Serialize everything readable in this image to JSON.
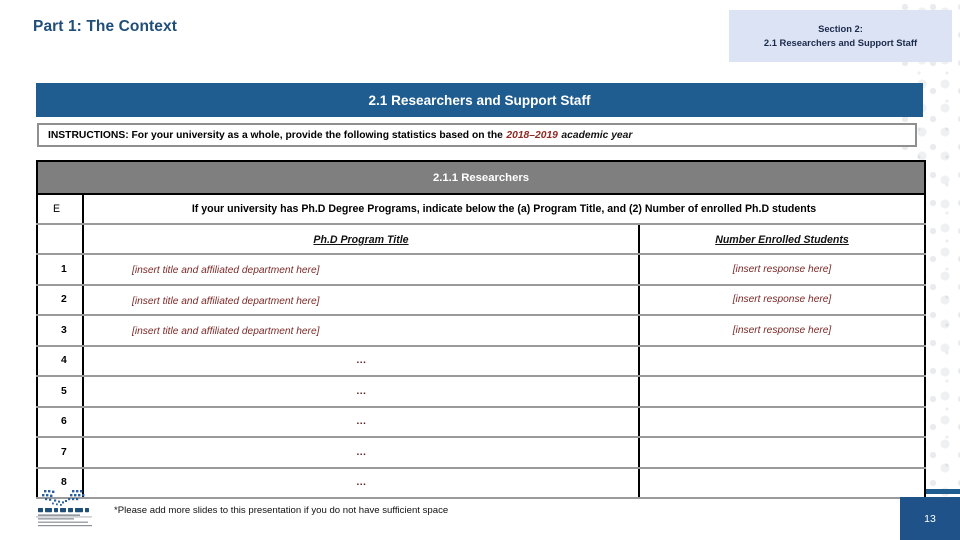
{
  "slide": {
    "title": "Part 1: The Context",
    "page_number": "13",
    "accent_blue": "#1f5c8f",
    "tag_bg": "#dce3f5",
    "subhead_gray": "#7f7f7f",
    "placeholder_red": "#7b2a28"
  },
  "section_tag": {
    "line1": "Section 2:",
    "line2": "2.1 Researchers and Support Staff"
  },
  "banner": {
    "label": "2.1 Researchers and Support Staff"
  },
  "instructions": {
    "lead": "INSTRUCTIONS: For your university as a whole, provide the following statistics based on the",
    "year": "2018–2019",
    "trailing": "academic year"
  },
  "table": {
    "subhead": "2.1.1 Researchers",
    "prompt_letter": "E",
    "prompt_text": "If your university has Ph.D Degree Programs, indicate below the (a) Program Title, and (2) Number of enrolled Ph.D students",
    "col_headers": {
      "title": "Ph.D Program Title",
      "enrolled": "Number Enrolled Students"
    },
    "rows": [
      {
        "num": "1",
        "title": "[insert title and affiliated department here]",
        "enrolled": "[insert response here]",
        "style": "filled"
      },
      {
        "num": "2",
        "title": "[insert title and affiliated department here]",
        "enrolled": "[insert response here]",
        "style": "filled"
      },
      {
        "num": "3",
        "title": "[insert title and affiliated department here]",
        "enrolled": "[insert response here]",
        "style": "filled"
      },
      {
        "num": "4",
        "title": "…",
        "enrolled": "",
        "style": "dots"
      },
      {
        "num": "5",
        "title": "…",
        "enrolled": "",
        "style": "dots"
      },
      {
        "num": "6",
        "title": "…",
        "enrolled": "",
        "style": "dots"
      },
      {
        "num": "7",
        "title": "…",
        "enrolled": "",
        "style": "dots"
      },
      {
        "num": "8",
        "title": "…",
        "enrolled": "",
        "style": "dots"
      }
    ]
  },
  "footer": {
    "note": "*Please add more slides to this presentation if you do not have sufficient space",
    "logo_name": "ministry-of-education-logo"
  }
}
